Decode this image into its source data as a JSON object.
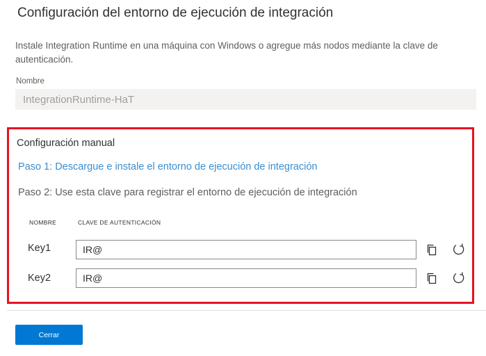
{
  "dialog": {
    "title": "Configuración del entorno de ejecución de integración",
    "description": "Instale Integration Runtime en una máquina con Windows o agregue más nodos mediante la clave de autenticación."
  },
  "name_field": {
    "label": "Nombre",
    "value": "IntegrationRuntime-HaT"
  },
  "manual_setup": {
    "title": "Configuración manual",
    "step1_link": "Paso 1: Descargue e instale el entorno de ejecución de integración",
    "step2_text": "Paso 2: Use esta clave para registrar el entorno de ejecución de integración",
    "columns": {
      "name": "NOMBRE",
      "key": "CLAVE DE AUTENTICACIÓN"
    },
    "keys": [
      {
        "name": "Key1",
        "value": "IR@"
      },
      {
        "name": "Key2",
        "value": "IR@"
      }
    ]
  },
  "footer": {
    "close_label": "Cerrar"
  },
  "colors": {
    "highlight_border": "#e81123",
    "link": "#3b8ed0",
    "primary_button": "#0078d4"
  },
  "icons": [
    "copy-icon",
    "refresh-icon"
  ]
}
